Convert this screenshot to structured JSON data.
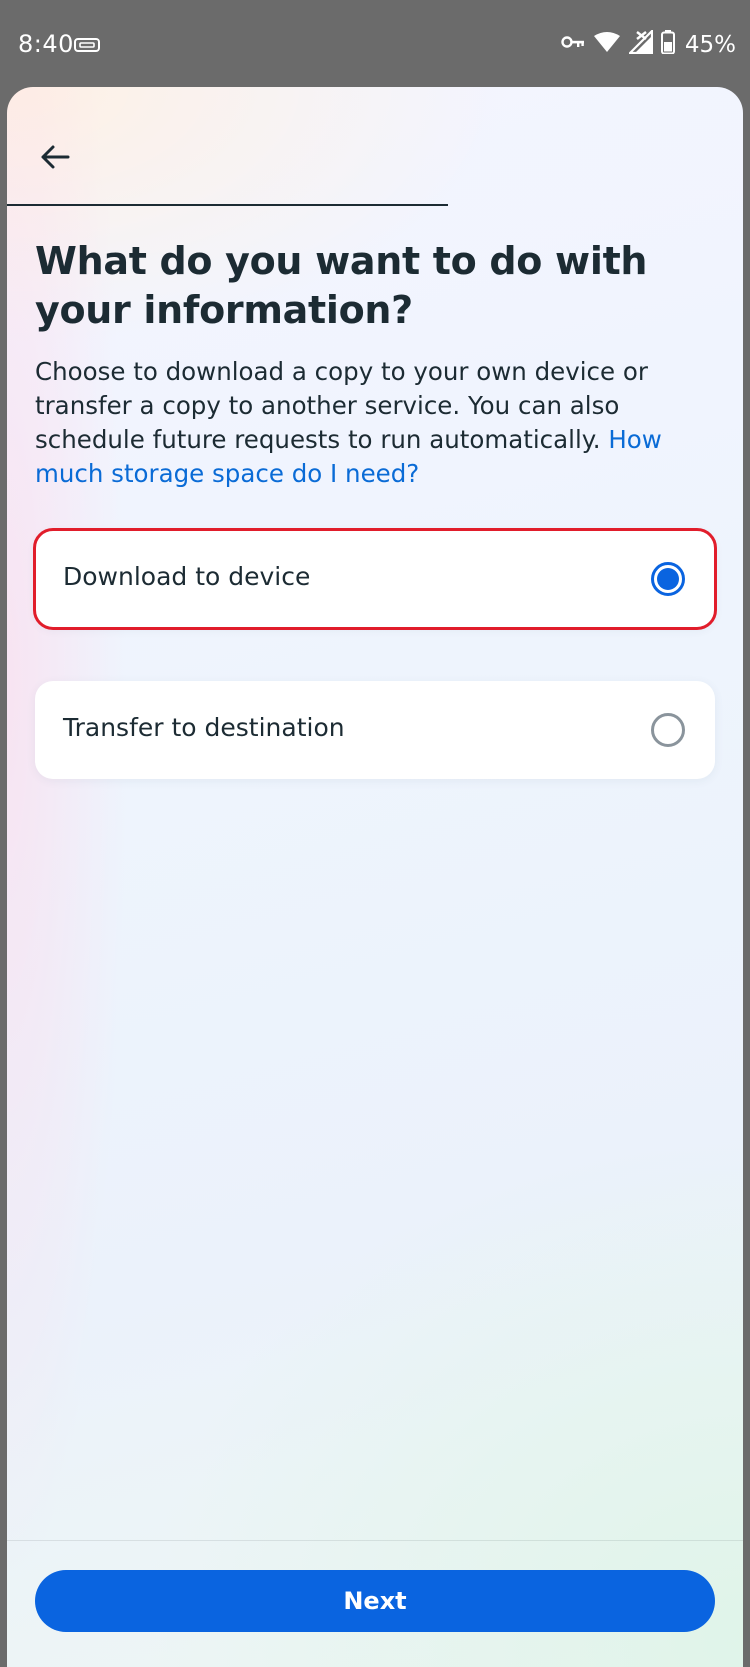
{
  "status_bar": {
    "time": "8:40",
    "battery": "45%",
    "icons": [
      "vpn-icon",
      "key-icon",
      "wifi-icon",
      "cellular-icon",
      "battery-icon"
    ]
  },
  "header": {
    "back_icon": "arrow-left-icon"
  },
  "main": {
    "title": "What do you want to do with your information?",
    "description": "Choose to download a copy to your own device or transfer a copy to another service. You can also schedule future requests to run automatically. ",
    "help_link": "How much storage space do I need?",
    "options": [
      {
        "label": "Download to device",
        "selected": true
      },
      {
        "label": "Transfer to destination",
        "selected": false
      }
    ]
  },
  "footer": {
    "next_label": "Next"
  },
  "colors": {
    "primary": "#0a64e0",
    "link": "#0a6bd6",
    "text": "#1c2b33",
    "highlight": "#e11d2b"
  }
}
